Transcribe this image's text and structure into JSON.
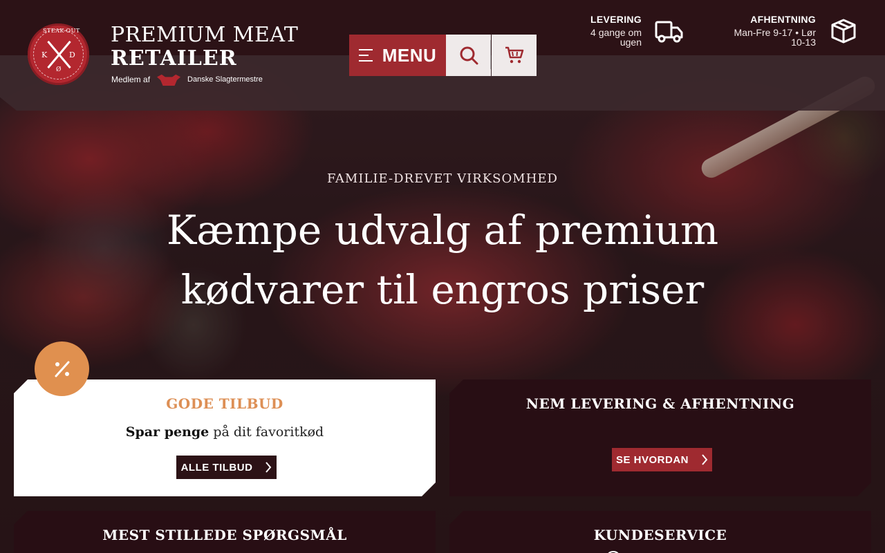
{
  "header": {
    "brand_line1": "PREMIUM MEAT",
    "brand_line2": "RETAILER",
    "logo_text": "STEAK-OUT",
    "logo_letters": [
      "K",
      "D",
      "Ø"
    ],
    "member_prefix": "Medlem af",
    "member_org": "Danske Slagtermestre",
    "menu_label": "MENU",
    "delivery": {
      "title": "LEVERING",
      "text": "4 gange om ugen"
    },
    "pickup": {
      "title": "AFHENTNING",
      "text": "Man-Fre 9-17 • Lør 10-13"
    }
  },
  "hero": {
    "eyebrow": "FAMILIE-DREVET VIRKSOMHED",
    "title": "Kæmpe udvalg af premium kødvarer til engros priser"
  },
  "cards": {
    "offers": {
      "title": "GODE TILBUD",
      "sub_bold": "Spar penge",
      "sub_rest": " på dit favoritkød",
      "button": "ALLE TILBUD"
    },
    "delivery": {
      "title": "NEM LEVERING & AFHENTNING",
      "button": "SE HVORDAN"
    },
    "faq": {
      "title": "MEST STILLEDE SPØRGSMÅL"
    },
    "service": {
      "title": "KUNDESERVICE"
    }
  },
  "colors": {
    "brand_red": "#9f2a30",
    "dark_maroon": "#2c1216",
    "accent_orange": "#dd8f55"
  }
}
